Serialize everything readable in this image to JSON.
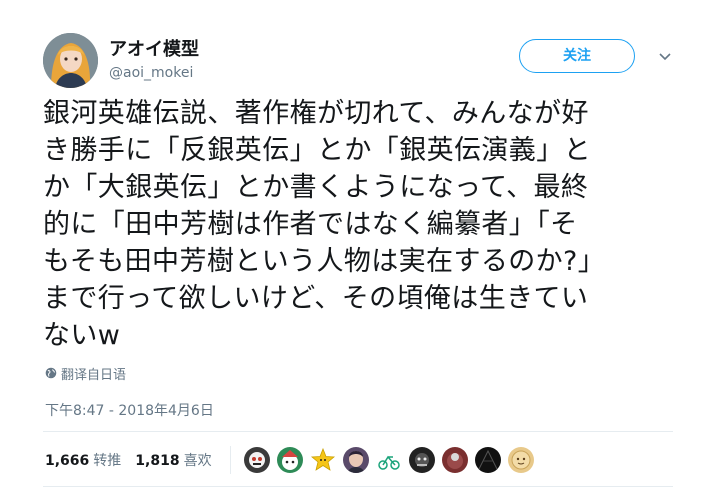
{
  "user": {
    "display_name": "アオイ模型",
    "handle": "@aoi_mokei"
  },
  "follow_button": {
    "label": "关注"
  },
  "tweet": {
    "lines": [
      "銀河英雄伝説、著作権が切れて、みんなが好",
      "き勝手に「反銀英伝」とか「銀英伝演義」と",
      "か「大銀英伝」とか書くようになって、最終",
      "的に「田中芳樹は作者ではなく編纂者」「そ",
      "もそも田中芳樹という人物は実在するのか?」",
      "まで行って欲しいけど、その頃俺は生きてい",
      "ないw"
    ]
  },
  "translate": {
    "label": "翻译自日语",
    "icon": "globe-icon"
  },
  "timestamp": "下午8:47 - 2018年4月6日",
  "stats": {
    "retweets": {
      "count": "1,666",
      "label": "转推"
    },
    "likes": {
      "count": "1,818",
      "label": "喜欢"
    }
  },
  "likers": [
    {
      "name": "liker-avatar-1",
      "color": "#3a3a3a"
    },
    {
      "name": "liker-avatar-2",
      "color": "#2e8b57"
    },
    {
      "name": "liker-avatar-3",
      "color": "#f5c518"
    },
    {
      "name": "liker-avatar-4",
      "color": "#5a4a6a"
    },
    {
      "name": "liker-avatar-5",
      "color": "#1aa37a"
    },
    {
      "name": "liker-avatar-6",
      "color": "#222222"
    },
    {
      "name": "liker-avatar-7",
      "color": "#7a2f2f"
    },
    {
      "name": "liker-avatar-8",
      "color": "#111111"
    },
    {
      "name": "liker-avatar-9",
      "color": "#e8c98a"
    }
  ],
  "colors": {
    "accent": "#1da1f2",
    "text": "#14171a",
    "secondary": "#657786",
    "divider": "#e6ecf0"
  }
}
